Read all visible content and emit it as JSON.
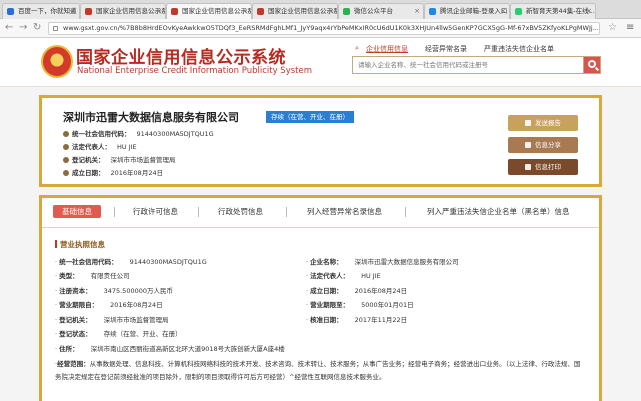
{
  "browser": {
    "tabs": [
      {
        "label": "百度一下，你就知道",
        "active": false
      },
      {
        "label": "国家企业信用信息公示系统",
        "active": false
      },
      {
        "label": "国家企业信用信息公示系统",
        "active": true
      },
      {
        "label": "国家企业信用信息公示系统",
        "active": false
      },
      {
        "label": "微信公众平台",
        "active": false
      },
      {
        "label": "腾讯企业邮箱-登录入口",
        "active": false
      },
      {
        "label": "新智育天第44集-在线...",
        "active": false
      }
    ],
    "url": "www.gsxt.gov.cn/%7B8b8HrdEOvKyeAwkkwO5TDQf3_EeRSRMdFghLMf1_JyY9aqx4rYbPeMKxIR0cU6dU1K0k3XHJUn4llw5GenKP7GCX5gG-Mf-67xBV5ZKfyoKLPgMWJj..."
  },
  "header": {
    "title_cn": "国家企业信用信息公示系统",
    "title_en": "National Enterprise Credit Information Publicity System",
    "nav": [
      "企业信用信息",
      "经营异常名录",
      "严重违法失信企业名单"
    ],
    "search_placeholder": "请输入企业名称、统一社会信用代码或注册号"
  },
  "company": {
    "name": "深圳市迅雷大数据信息服务有限公司",
    "status": "存续（在营、开业、在册）",
    "rows": [
      {
        "label": "统一社会信用代码：",
        "value": "91440300MA5DJTQU1G"
      },
      {
        "label": "法定代表人：",
        "value": "HU JIE"
      },
      {
        "label": "登记机关：",
        "value": "深圳市市场监督管理局"
      },
      {
        "label": "成立日期：",
        "value": "2016年08月24日"
      }
    ],
    "actions": [
      {
        "label": "发送报告",
        "color": "#c8a25a"
      },
      {
        "label": "信息分享",
        "color": "#a77a52"
      },
      {
        "label": "信息打印",
        "color": "#7a4a2b"
      }
    ]
  },
  "tabs": [
    "基础信息",
    "行政许可信息",
    "行政处罚信息",
    "列入经营异常名录信息",
    "列入严重违法失信企业名单（黑名单）信息"
  ],
  "license": {
    "section_title": "营业执照信息",
    "fields": [
      {
        "label": "统一社会信用代码：",
        "value": "91440300MA5DJTQU1G"
      },
      {
        "label": "企业名称：",
        "value": "深圳市迅雷大数据信息服务有限公司"
      },
      {
        "label": "类型：",
        "value": "有限责任公司"
      },
      {
        "label": "法定代表人：",
        "value": "HU JIE"
      },
      {
        "label": "注册资本：",
        "value": "3475.500000万人民币"
      },
      {
        "label": "成立日期：",
        "value": "2016年08月24日"
      },
      {
        "label": "营业期限自：",
        "value": "2016年08月24日"
      },
      {
        "label": "营业期限至：",
        "value": "5000年01月01日"
      },
      {
        "label": "登记机关：",
        "value": "深圳市市场监督管理局"
      },
      {
        "label": "核准日期：",
        "value": "2017年11月22日"
      },
      {
        "label": "登记状态：",
        "value": "存续（在营、开业、在册）"
      },
      {
        "label": "住所：",
        "value": "深圳市南山区西丽街道高新区北环大道9018号大族创新大厦A座4楼"
      }
    ],
    "scope_label": "经营范围：",
    "scope_value": "从事数据处理、信息科技、计算机科技网络科技的技术开发、技术咨询、技术转让、技术服务；从事广告业务；经营电子商务；经营进出口业务。（以上法律、行政法规、国务院决定规定在登记前须经批准的项目除外，限制的项目须取得许可后方可经营）^经营性互联网信息技术服务业。"
  }
}
